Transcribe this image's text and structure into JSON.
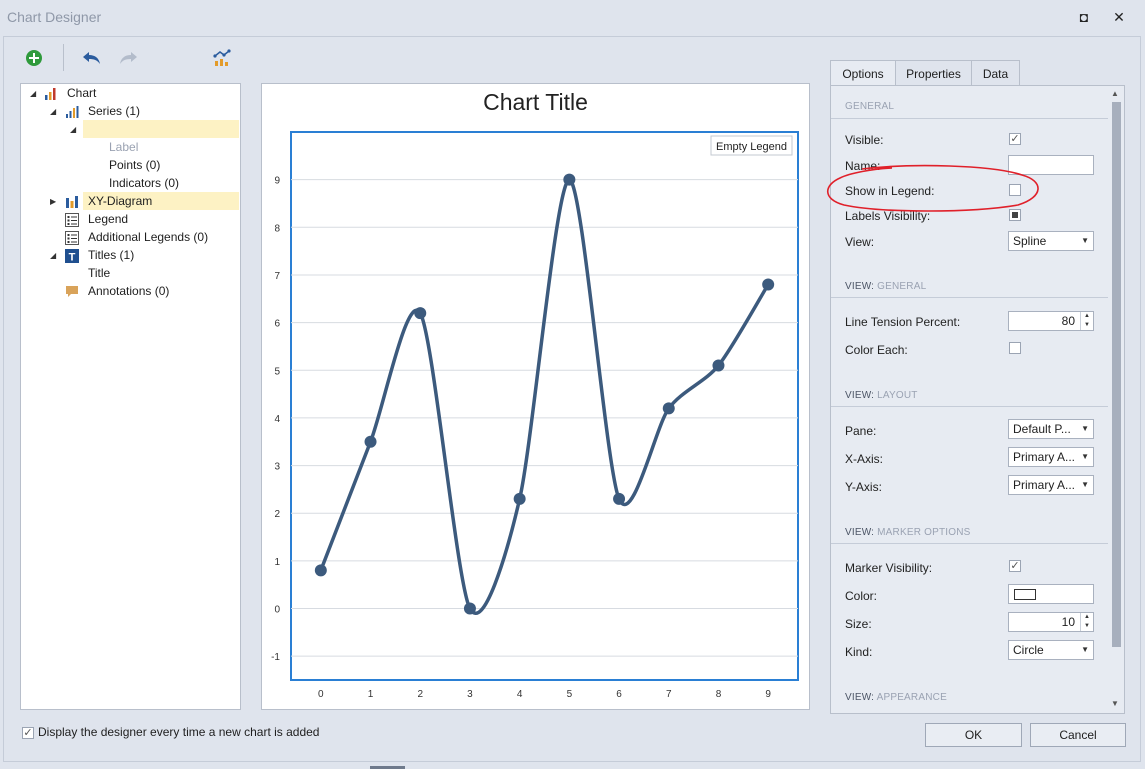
{
  "window": {
    "title": "Chart Designer",
    "restore_glyph": "◘",
    "close_glyph": "✕"
  },
  "toolbar": {
    "icons": [
      "add-icon",
      "undo-icon",
      "redo-icon",
      "chart-wizard-icon"
    ]
  },
  "tree": {
    "items": [
      {
        "label": "Chart"
      },
      {
        "label": "Series (1)"
      },
      {
        "label": ""
      },
      {
        "label": "Label"
      },
      {
        "label": "Points (0)"
      },
      {
        "label": "Indicators (0)"
      },
      {
        "label": "XY-Diagram"
      },
      {
        "label": "Legend"
      },
      {
        "label": "Additional Legends (0)"
      },
      {
        "label": "Titles (1)"
      },
      {
        "label": "Title"
      },
      {
        "label": "Annotations (0)"
      }
    ]
  },
  "chart_data": {
    "type": "line",
    "title": "Chart Title",
    "legend_text": "Empty Legend",
    "x": [
      0,
      1,
      2,
      3,
      4,
      5,
      6,
      7,
      8,
      9
    ],
    "values": [
      0.8,
      3.5,
      6.2,
      0.0,
      2.3,
      9.0,
      2.3,
      4.2,
      5.1,
      6.8
    ],
    "xlim": [
      -0.6,
      9.6
    ],
    "ylim": [
      -1.5,
      10
    ],
    "x_ticks": [
      "0",
      "1",
      "2",
      "3",
      "4",
      "5",
      "6",
      "7",
      "8",
      "9"
    ],
    "y_ticks": [
      "-1",
      "0",
      "1",
      "2",
      "3",
      "4",
      "5",
      "6",
      "7",
      "8",
      "9"
    ],
    "y_tick_values": [
      -1,
      0,
      1,
      2,
      3,
      4,
      5,
      6,
      7,
      8,
      9
    ],
    "line_style": "spline",
    "series_color": "#3c5a7d",
    "grid": true,
    "legend_position": "top-right"
  },
  "tabs": [
    {
      "label": "Options"
    },
    {
      "label": "Properties"
    },
    {
      "label": "Data"
    }
  ],
  "options": {
    "sec_general": "GENERAL",
    "visible_label": "Visible:",
    "visible_checked": "✓",
    "name_label": "Name:",
    "name_value": "",
    "show_legend_label": "Show in Legend:",
    "labels_visibility_label": "Labels Visibility:",
    "view_label": "View:",
    "view_value": "Spline",
    "sec_view_general_prefix": "VIEW:",
    "sec_view_general": " GENERAL",
    "line_tension_label": "Line Tension Percent:",
    "line_tension_value": "80",
    "color_each_label": "Color Each:",
    "sec_view_layout_prefix": "VIEW:",
    "sec_view_layout": " LAYOUT",
    "pane_label": "Pane:",
    "pane_value": "Default P...",
    "xaxis_label": "X-Axis:",
    "xaxis_value": "Primary A...",
    "yaxis_label": "Y-Axis:",
    "yaxis_value": "Primary A...",
    "sec_marker_prefix": "VIEW:",
    "sec_marker": " MARKER OPTIONS",
    "marker_visibility_label": "Marker Visibility:",
    "marker_visibility_checked": "✓",
    "color_label": "Color:",
    "size_label": "Size:",
    "size_value": "10",
    "kind_label": "Kind:",
    "kind_value": "Circle",
    "sec_appearance_prefix": "VIEW:",
    "sec_appearance": " APPEARANCE"
  },
  "footer": {
    "checkbox_label": "Display the designer every time a new chart is added",
    "checkbox_checked": "✓",
    "ok_label": "OK",
    "cancel_label": "Cancel"
  },
  "annotation_color": "#e0202a"
}
